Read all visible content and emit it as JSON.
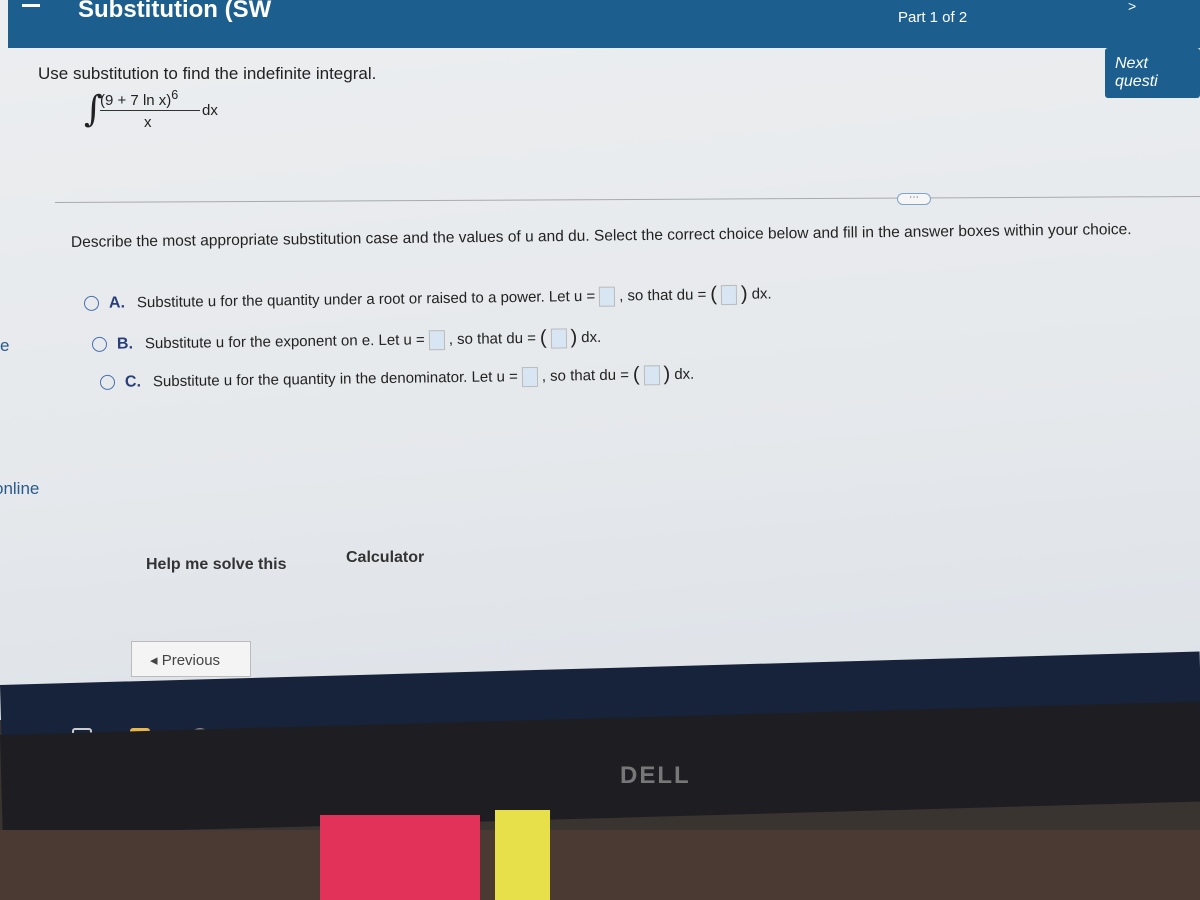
{
  "header": {
    "title": "Substitution (SW",
    "part": "Part 1 of 2",
    "next_label": "Next questi"
  },
  "question": {
    "prompt": "Use substitution to find the indefinite integral.",
    "integral": {
      "sign": "∫",
      "numerator": "(9 + 7 ln x)",
      "exponent": "6",
      "denominator": "x",
      "dx": "dx"
    }
  },
  "more_button": "⋯",
  "instructions": "Describe the most appropriate substitution case and the values of u and du. Select the correct choice below and fill in the answer boxes within your choice.",
  "choices": [
    {
      "letter": "A.",
      "text": "Substitute u for the quantity under a root or raised to a power. Let u =",
      "mid": ", so that du =",
      "end": "dx."
    },
    {
      "letter": "B.",
      "text": "Substitute u for the exponent on e. Let u =",
      "mid": ", so that du =",
      "end": "dx."
    },
    {
      "letter": "C.",
      "text": "Substitute u for the quantity in the denominator. Let u =",
      "mid": ", so that du =",
      "end": "dx."
    }
  ],
  "sidebar": {
    "e_text": "e",
    "online_text": "online"
  },
  "buttons": {
    "help": "Help me solve this",
    "calculator": "Calculator",
    "previous": "◂ Previous"
  },
  "monitor": {
    "brand": "DELL"
  },
  "colors": {
    "header": "#1c5f8e",
    "radio": "#4a6fb0",
    "taskbar": "#17233a"
  }
}
